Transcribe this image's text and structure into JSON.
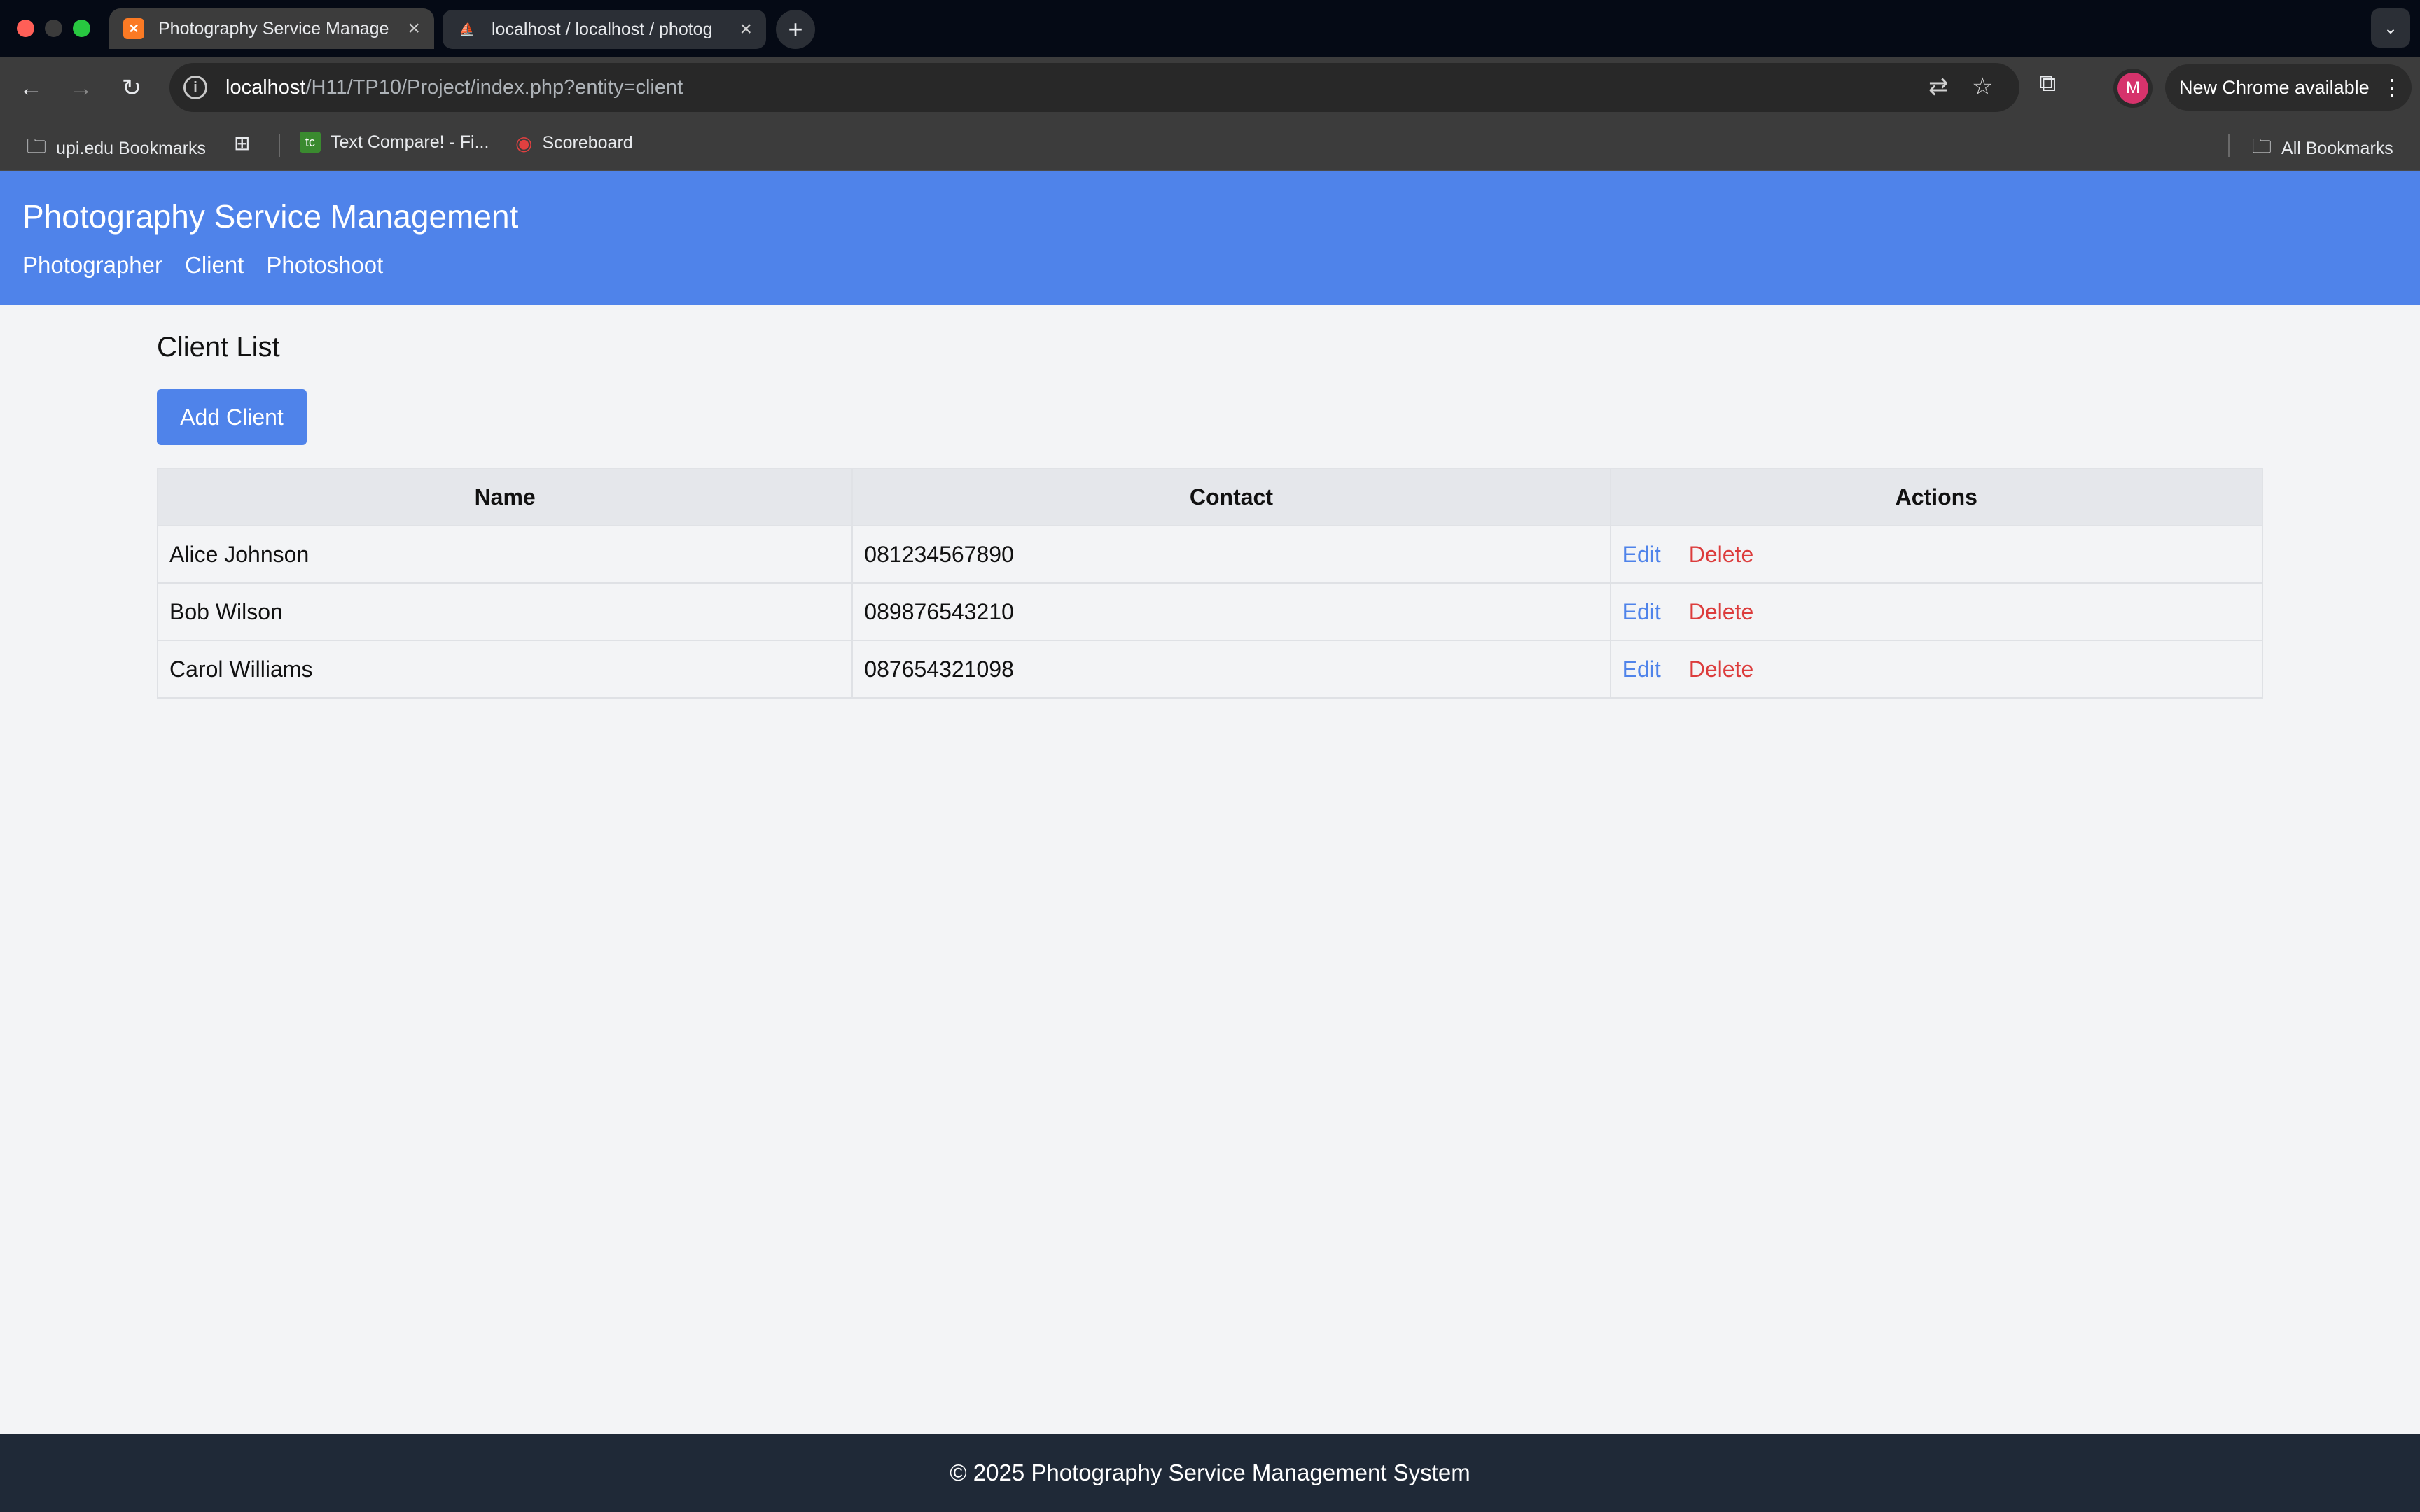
{
  "browser": {
    "tabs": [
      {
        "title": "Photography Service Manage",
        "active": true,
        "favicon": "xampp-icon"
      },
      {
        "title": "localhost / localhost / photog",
        "active": false,
        "favicon": "phpmyadmin-icon"
      }
    ],
    "url": {
      "host": "localhost",
      "path": "/H11/TP10/Project/index.php?entity=client"
    },
    "profile_initial": "M",
    "update_label": "New Chrome available",
    "bookmarks": [
      {
        "label": "upi.edu Bookmarks",
        "icon": "folder-icon"
      },
      {
        "label": "",
        "icon": "apps-grid-icon"
      },
      {
        "label": "Text Compare! - Fi...",
        "icon": "tc-icon"
      },
      {
        "label": "Scoreboard",
        "icon": "scoreboard-icon"
      }
    ],
    "all_bookmarks_label": "All Bookmarks"
  },
  "app": {
    "title": "Photography Service Management",
    "nav": [
      "Photographer",
      "Client",
      "Photoshoot"
    ]
  },
  "main": {
    "heading": "Client List",
    "add_button": "Add Client",
    "table": {
      "headers": [
        "Name",
        "Contact",
        "Actions"
      ],
      "rows": [
        {
          "name": "Alice Johnson",
          "contact": "081234567890",
          "edit": "Edit",
          "delete": "Delete"
        },
        {
          "name": "Bob Wilson",
          "contact": "089876543210",
          "edit": "Edit",
          "delete": "Delete"
        },
        {
          "name": "Carol Williams",
          "contact": "087654321098",
          "edit": "Edit",
          "delete": "Delete"
        }
      ]
    }
  },
  "footer": {
    "text": "© 2025 Photography Service Management System"
  },
  "colors": {
    "primary": "#4f83ea",
    "danger": "#dc3c3c",
    "footer_bg": "#1f2937",
    "page_bg": "#f3f4f6"
  }
}
